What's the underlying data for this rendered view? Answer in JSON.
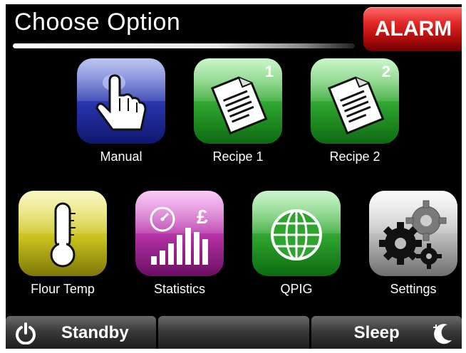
{
  "header": {
    "title": "Choose Option",
    "alarm_label": "ALARM"
  },
  "tiles": [
    {
      "label": "Manual",
      "icon": "hand-pointer-icon",
      "color": "#2633a8"
    },
    {
      "label": "Recipe 1",
      "icon": "document-icon",
      "badge": "1",
      "color": "#2ea32e"
    },
    {
      "label": "Recipe 2",
      "icon": "document-icon",
      "badge": "2",
      "color": "#2ea32e"
    },
    {
      "label": "Flour Temp",
      "icon": "thermometer-icon",
      "color": "#c9c21e"
    },
    {
      "label": "Statistics",
      "icon": "statistics-icon",
      "symbol": "£",
      "color": "#b12fa3"
    },
    {
      "label": "QPIG",
      "icon": "globe-icon",
      "color": "#2ea32e"
    },
    {
      "label": "Settings",
      "icon": "gears-icon",
      "color": "#b9b9b9"
    }
  ],
  "bottom_bar": {
    "standby_label": "Standby",
    "sleep_label": "Sleep"
  }
}
